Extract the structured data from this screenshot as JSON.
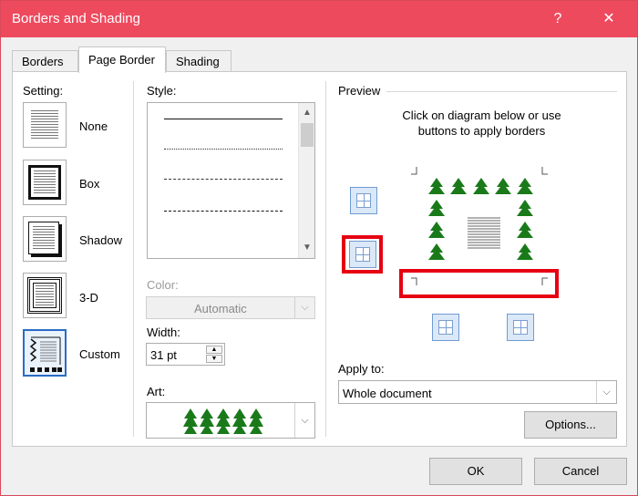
{
  "window": {
    "title": "Borders and Shading",
    "help_glyph": "?",
    "close_glyph": "✕"
  },
  "tabs": [
    {
      "label": "Borders"
    },
    {
      "label": "Page Border"
    },
    {
      "label": "Shading"
    }
  ],
  "setting": {
    "label": "Setting:",
    "options": [
      {
        "label": "None"
      },
      {
        "label": "Box"
      },
      {
        "label": "Shadow"
      },
      {
        "label": "3-D"
      },
      {
        "label": "Custom"
      }
    ]
  },
  "style": {
    "label": "Style:"
  },
  "color": {
    "label": "Color:",
    "value": "Automatic"
  },
  "width": {
    "label": "Width:",
    "value": "31 pt"
  },
  "art": {
    "label": "Art:"
  },
  "preview": {
    "label": "Preview",
    "instruction_line1": "Click on diagram below or use",
    "instruction_line2": "buttons to apply borders"
  },
  "apply_to": {
    "label": "Apply to:",
    "value": "Whole document"
  },
  "buttons": {
    "options": "Options...",
    "ok": "OK",
    "cancel": "Cancel"
  },
  "colors": {
    "titlebar": "#ee4a5e",
    "highlight": "#e60012",
    "tree": "#1a7a1a",
    "selected": "#2a6cc4"
  }
}
